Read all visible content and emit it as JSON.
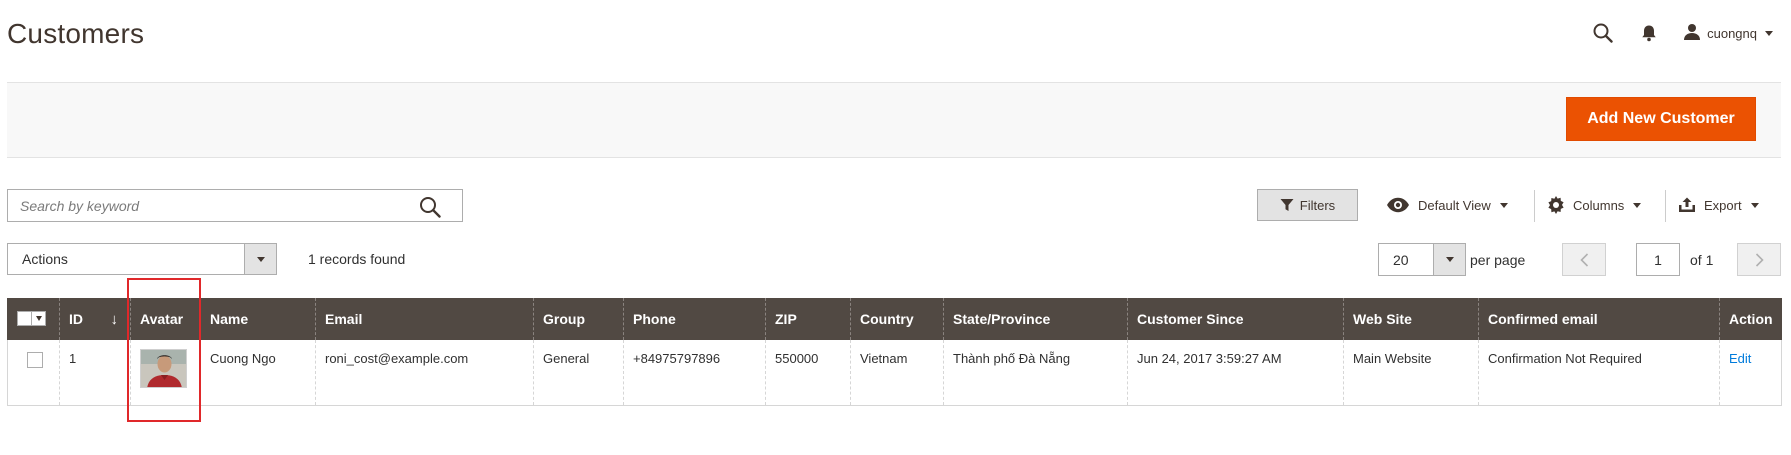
{
  "header": {
    "title": "Customers",
    "username": "cuongnq",
    "icons": {
      "search": "search-icon",
      "notifications": "bell-icon",
      "user": "user-icon"
    }
  },
  "page_actions": {
    "add_label": "Add New Customer"
  },
  "toolbar": {
    "search_placeholder": "Search by keyword",
    "filters_label": "Filters",
    "view_label": "Default View",
    "columns_label": "Columns",
    "export_label": "Export"
  },
  "grid_header": {
    "actions_label": "Actions",
    "records_found": "1 records found",
    "per_page_value": "20",
    "per_page_label": "per page",
    "current_page": "1",
    "page_of": "of 1"
  },
  "table": {
    "columns": [
      "",
      "ID",
      "Avatar",
      "Name",
      "Email",
      "Group",
      "Phone",
      "ZIP",
      "Country",
      "State/Province",
      "Customer Since",
      "Web Site",
      "Confirmed email",
      "Action"
    ],
    "sort_column": "ID",
    "sort_arrow": "↓",
    "rows": [
      {
        "id": "1",
        "name": "Cuong Ngo",
        "email": "roni_cost@example.com",
        "group": "General",
        "phone": "+84975797896",
        "zip": "550000",
        "country": "Vietnam",
        "state": "Thành phố Đà Nẵng",
        "customer_since": "Jun 24, 2017 3:59:27 AM",
        "website": "Main Website",
        "confirmed_email": "Confirmation Not Required",
        "action": "Edit"
      }
    ]
  },
  "colors": {
    "accent": "#eb5202",
    "header_bg": "#514943",
    "link": "#007bdb",
    "highlight": "#e0282a"
  }
}
